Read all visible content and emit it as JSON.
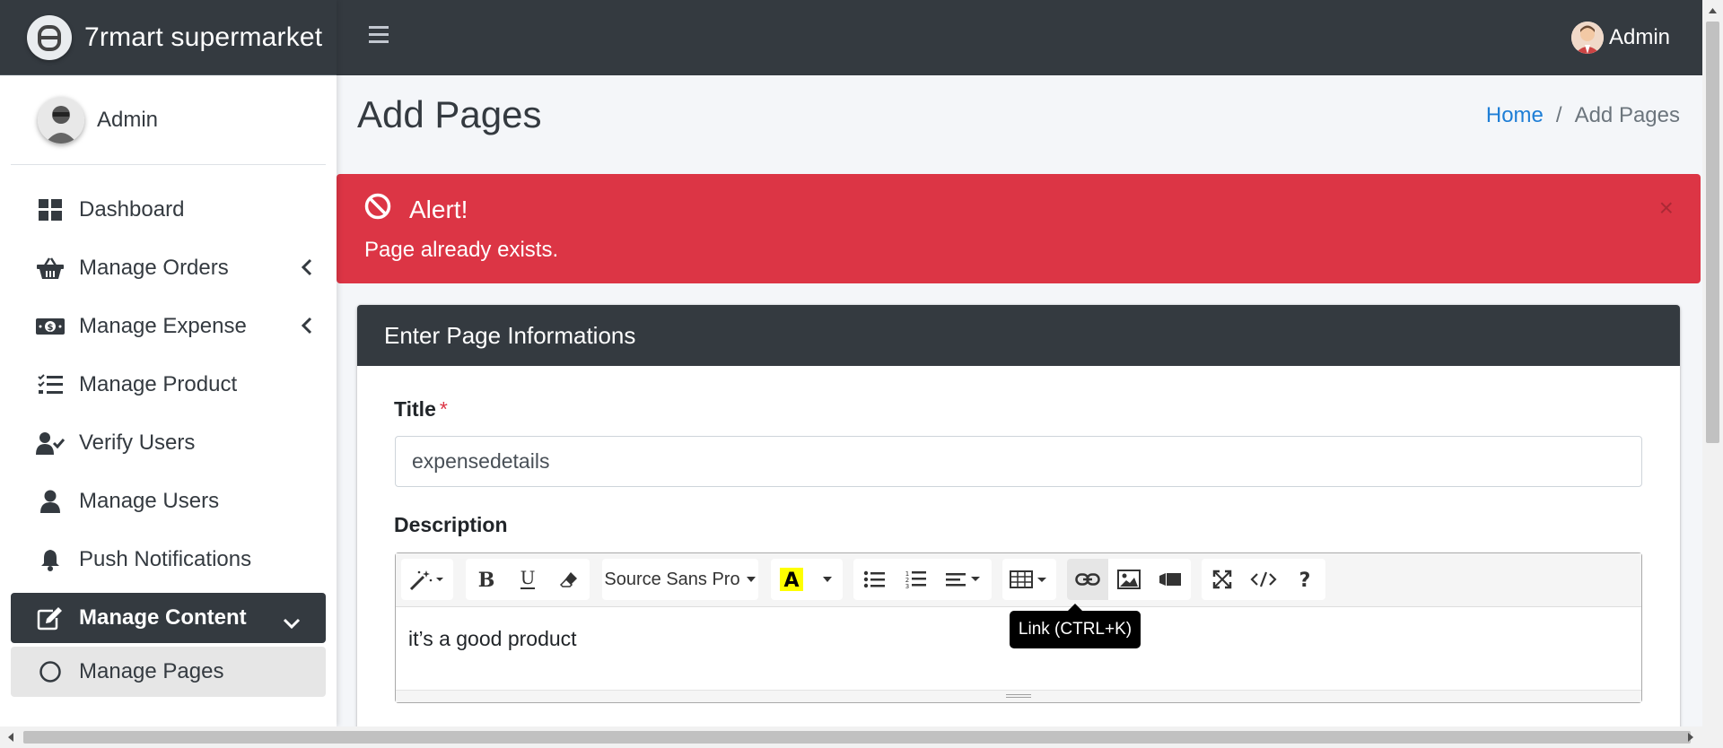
{
  "brand": {
    "name": "7rmart supermarket"
  },
  "sidebar": {
    "user": "Admin",
    "items": [
      {
        "label": "Dashboard",
        "icon": "dashboard-icon"
      },
      {
        "label": "Manage Orders",
        "icon": "basket-icon",
        "has_chevron": true
      },
      {
        "label": "Manage Expense",
        "icon": "money-bill-icon",
        "has_chevron": true
      },
      {
        "label": "Manage Product",
        "icon": "tasks-icon"
      },
      {
        "label": "Verify Users",
        "icon": "user-check-icon"
      },
      {
        "label": "Manage Users",
        "icon": "user-icon"
      },
      {
        "label": "Push Notifications",
        "icon": "bell-icon"
      },
      {
        "label": "Manage Content",
        "icon": "edit-icon",
        "active": true,
        "expanded": true
      },
      {
        "label": "Manage Pages",
        "icon": "circle-icon",
        "selected": true
      }
    ]
  },
  "topbar": {
    "user": "Admin"
  },
  "page": {
    "title": "Add Pages",
    "breadcrumb": {
      "home": "Home",
      "separator": "/",
      "current": "Add Pages"
    }
  },
  "alert": {
    "title": "Alert!",
    "message": "Page already exists.",
    "close": "×",
    "color": "#dc3545"
  },
  "card": {
    "header": "Enter Page Informations",
    "title_label": "Title",
    "required_mark": "*",
    "title_value": "expensedetails",
    "description_label": "Description",
    "editor": {
      "font_name": "Source Sans Pro",
      "content": "it’s a good product",
      "tooltip": "Link (CTRL+K)"
    }
  },
  "colors": {
    "navbar": "#343a40",
    "link": "#1e7ed6",
    "danger": "#dc3545"
  }
}
